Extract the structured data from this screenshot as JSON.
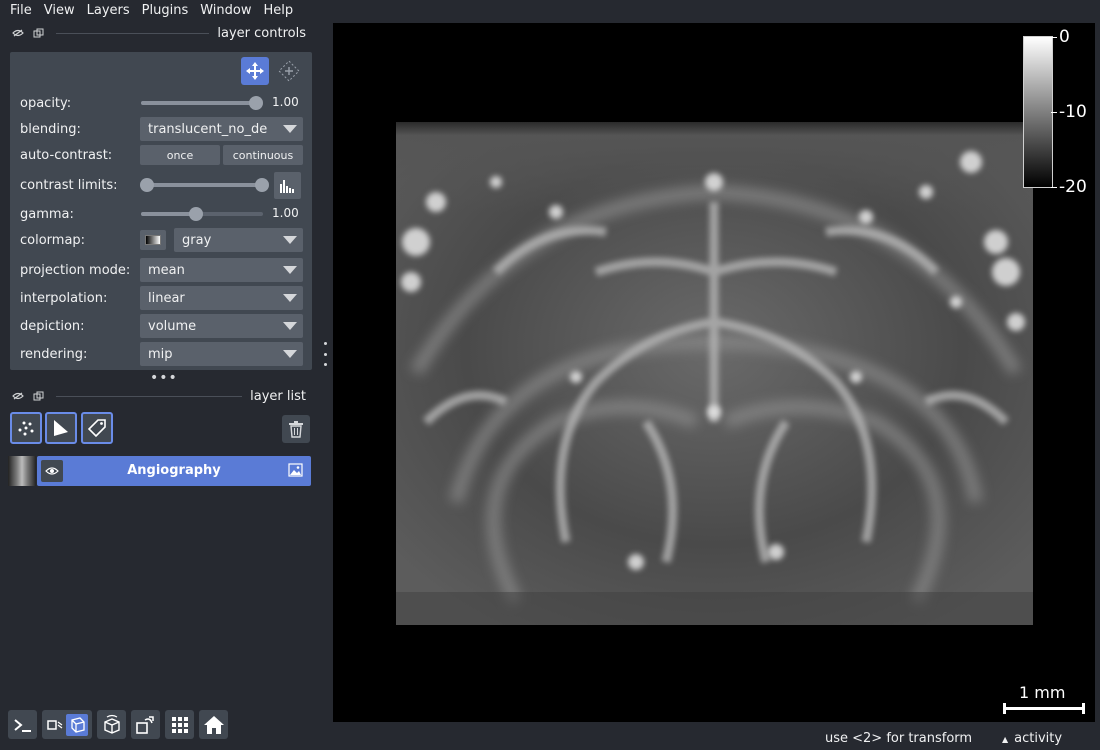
{
  "menu": [
    "File",
    "View",
    "Layers",
    "Plugins",
    "Window",
    "Help"
  ],
  "layer_controls": {
    "title": "layer controls",
    "opacity": {
      "label": "opacity:",
      "value": "1.00",
      "level": 1.0
    },
    "blending": {
      "label": "blending:",
      "value": "translucent_no_de"
    },
    "auto_contrast": {
      "label": "auto-contrast:",
      "once": "once",
      "continuous": "continuous"
    },
    "contrast_limits": {
      "label": "contrast limits:"
    },
    "gamma": {
      "label": "gamma:",
      "value": "1.00",
      "level": 0.45
    },
    "colormap": {
      "label": "colormap:",
      "value": "gray"
    },
    "projection_mode": {
      "label": "projection mode:",
      "value": "mean"
    },
    "interpolation": {
      "label": "interpolation:",
      "value": "linear"
    },
    "depiction": {
      "label": "depiction:",
      "value": "volume"
    },
    "rendering": {
      "label": "rendering:",
      "value": "mip"
    }
  },
  "layer_list": {
    "title": "layer list",
    "layers": [
      {
        "name": "Angiography",
        "visible": true,
        "selected": true
      }
    ]
  },
  "colorbar": {
    "ticks": [
      "0",
      "-10",
      "-20"
    ]
  },
  "scale_bar": {
    "label": "1 mm"
  },
  "status": {
    "message": "use <2> for transform",
    "activity": "activity"
  },
  "colors": {
    "accent": "#5a7bd6",
    "panel": "#414851",
    "background": "#262930",
    "canvas": "#000000"
  }
}
